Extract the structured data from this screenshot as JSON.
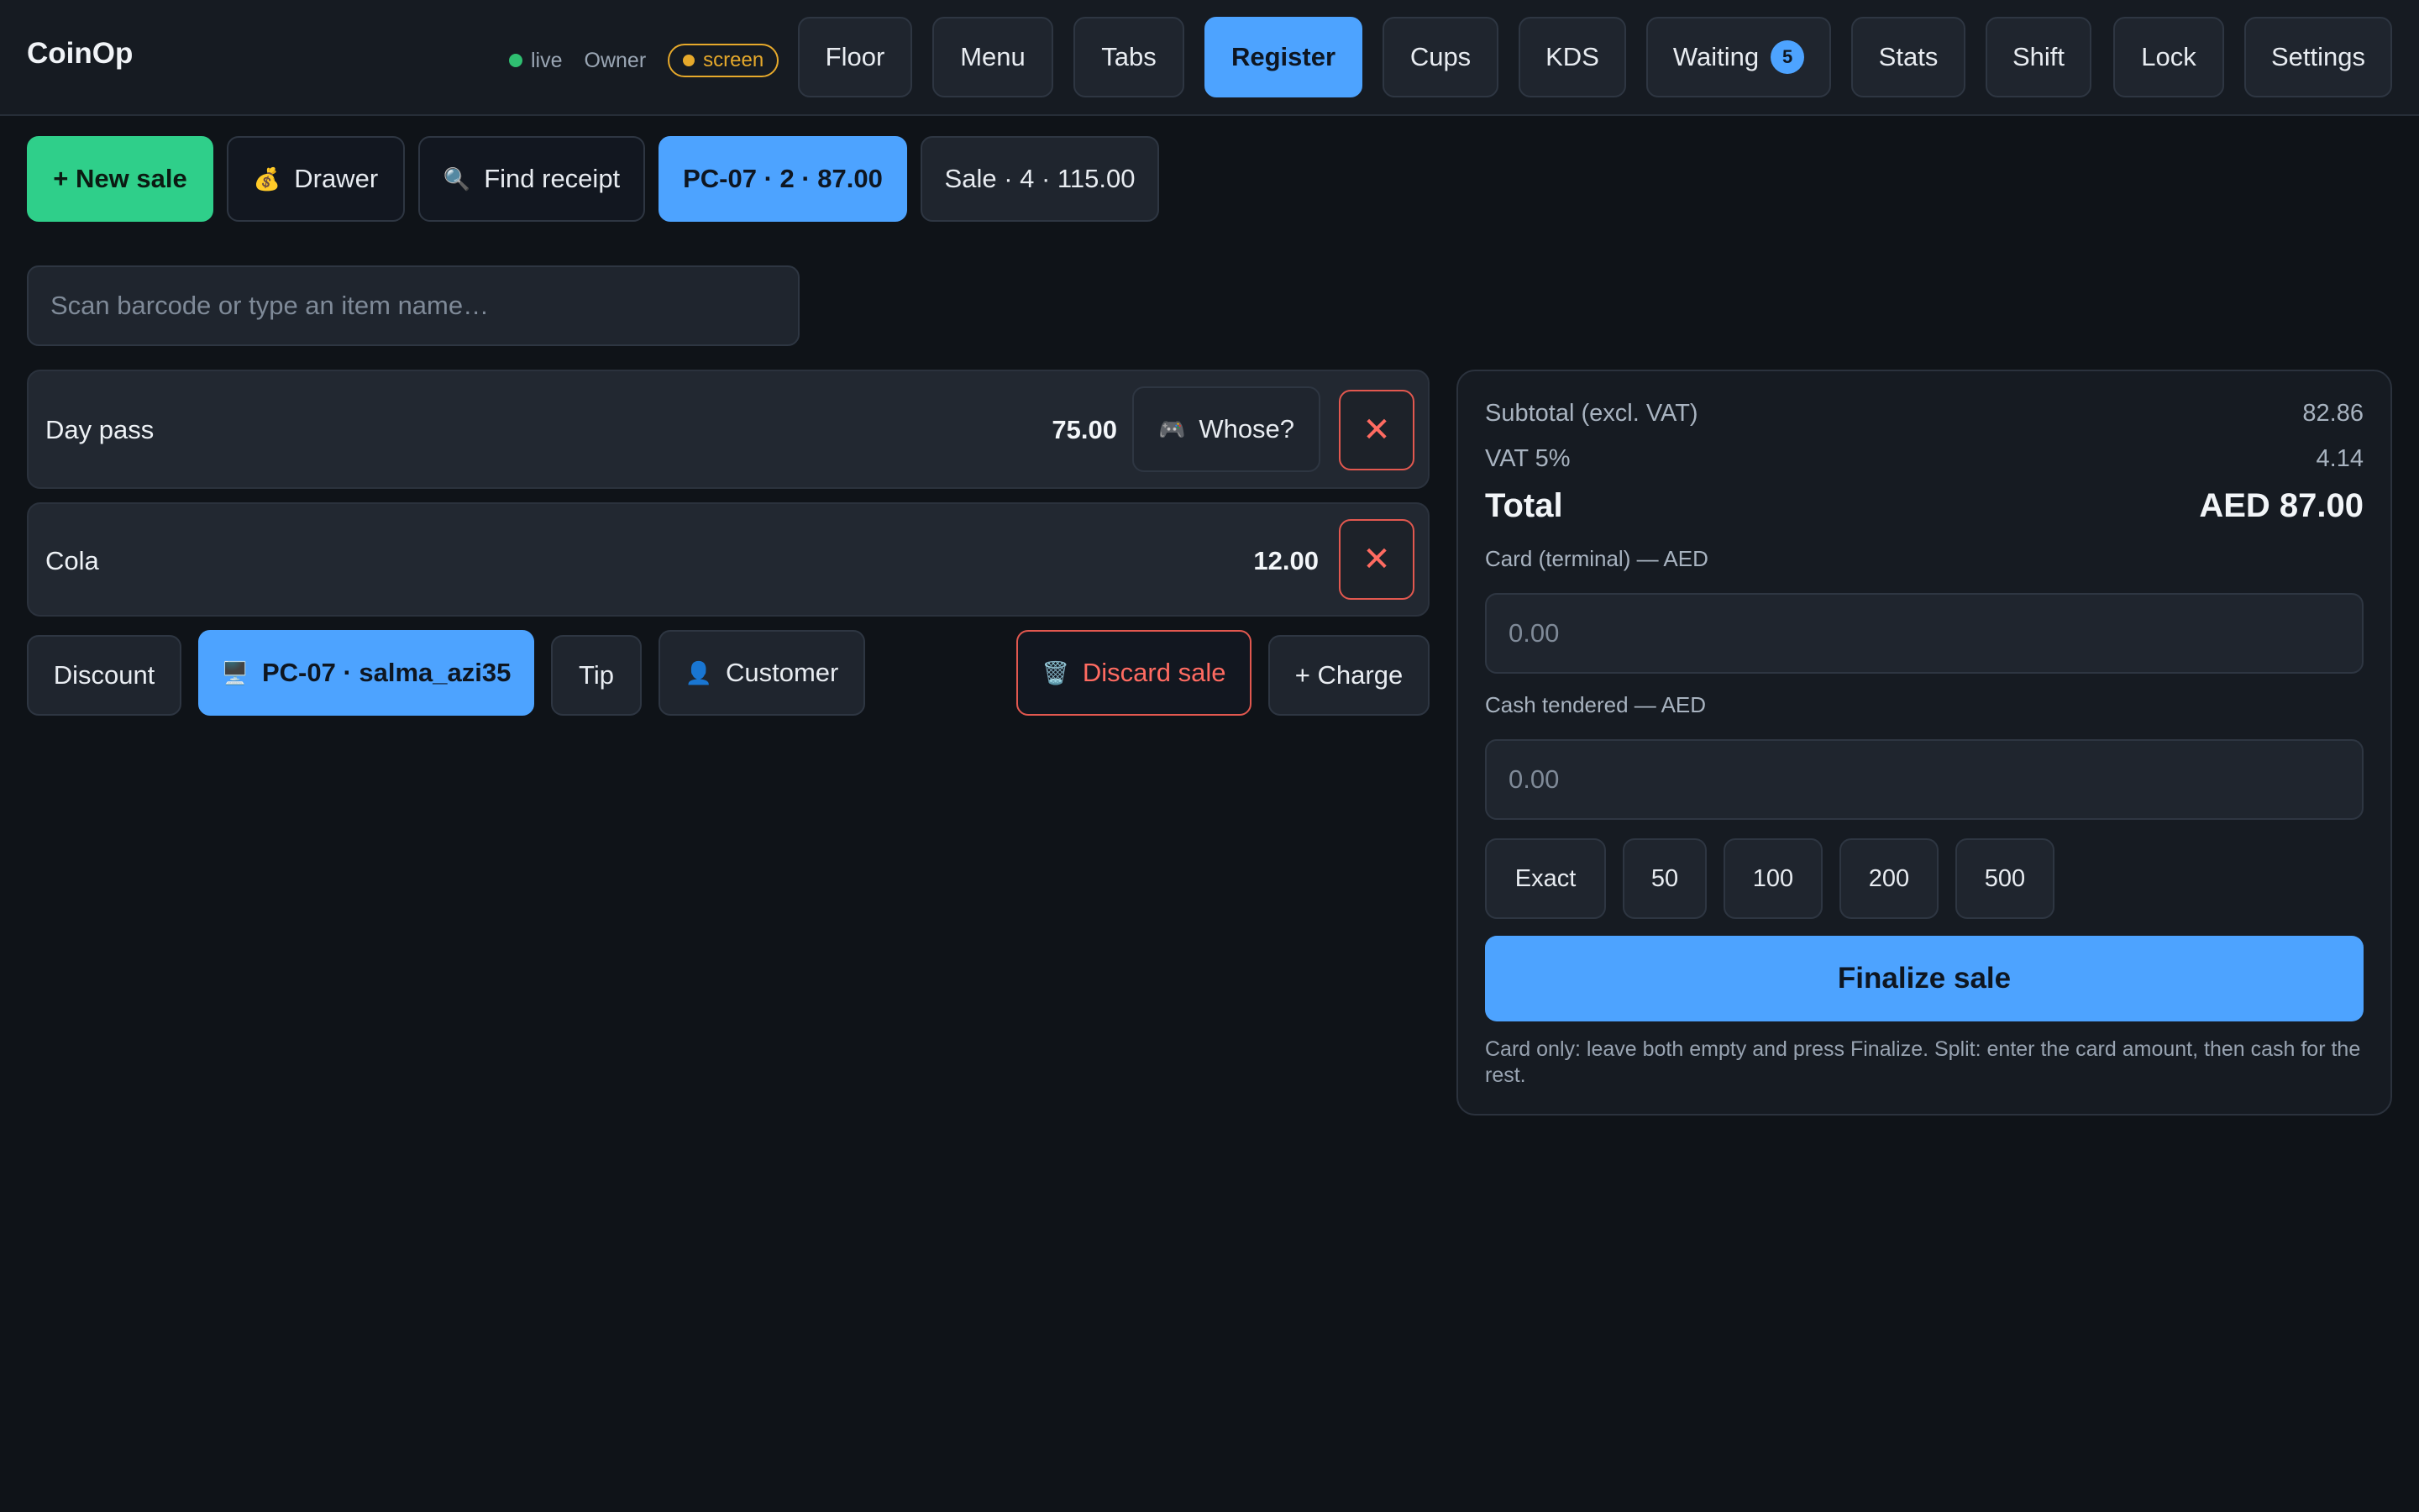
{
  "app": {
    "brand": "CoinOp",
    "status": {
      "live_label": "live",
      "role": "Owner",
      "mode_label": "screen"
    }
  },
  "nav": [
    {
      "id": "floor",
      "label": "Floor"
    },
    {
      "id": "menu",
      "label": "Menu"
    },
    {
      "id": "tabs",
      "label": "Tabs"
    },
    {
      "id": "register",
      "label": "Register",
      "active": true
    },
    {
      "id": "cups",
      "label": "Cups"
    },
    {
      "id": "kds",
      "label": "KDS"
    },
    {
      "id": "waiting",
      "label": "Waiting",
      "badge": "5"
    },
    {
      "id": "stats",
      "label": "Stats"
    },
    {
      "id": "shift",
      "label": "Shift"
    },
    {
      "id": "lock",
      "label": "Lock"
    },
    {
      "id": "settings",
      "label": "Settings"
    }
  ],
  "actions": {
    "new_sale": "+ New sale",
    "drawer": "Drawer",
    "find_receipt": "Find receipt",
    "sale_tabs": [
      {
        "label": "PC-07 · 2 · 87.00",
        "active": true
      },
      {
        "label": "Sale · 4 · 115.00"
      }
    ]
  },
  "search": {
    "placeholder": "Scan barcode or type an item name…",
    "value": ""
  },
  "cart": {
    "items": [
      {
        "name": "Day pass",
        "price": "75.00",
        "assign_label": "Whose?"
      },
      {
        "name": "Cola",
        "price": "12.00"
      }
    ],
    "controls": {
      "discount": "Discount",
      "station": "PC-07 · salma_azi35",
      "tip": "Tip",
      "customer": "Customer",
      "discard": "Discard sale",
      "charge": "+ Charge"
    }
  },
  "summary": {
    "subtotal_label": "Subtotal (excl. VAT)",
    "subtotal_value": "82.86",
    "vat_label": "VAT 5%",
    "vat_value": "4.14",
    "total_label": "Total",
    "total_value": "AED 87.00",
    "card_label": "Card (terminal) — AED",
    "card_placeholder": "0.00",
    "cash_label": "Cash tendered — AED",
    "cash_placeholder": "0.00",
    "quick": [
      "Exact",
      "50",
      "100",
      "200",
      "500"
    ],
    "finalize": "Finalize sale",
    "hint": "Card only: leave both empty and press Finalize. Split: enter the card amount, then cash for the rest."
  },
  "icons": {
    "drawer": "money-bag-icon",
    "find": "magnifier-icon",
    "whose": "gamepad-icon",
    "remove": "close-icon",
    "station": "monitor-icon",
    "customer": "person-icon",
    "discard": "trash-icon"
  },
  "colors": {
    "accent": "#4da3ff",
    "success": "#2fcf8a",
    "danger": "#e2584f",
    "warning": "#e6a92b",
    "background": "#0f1318"
  }
}
